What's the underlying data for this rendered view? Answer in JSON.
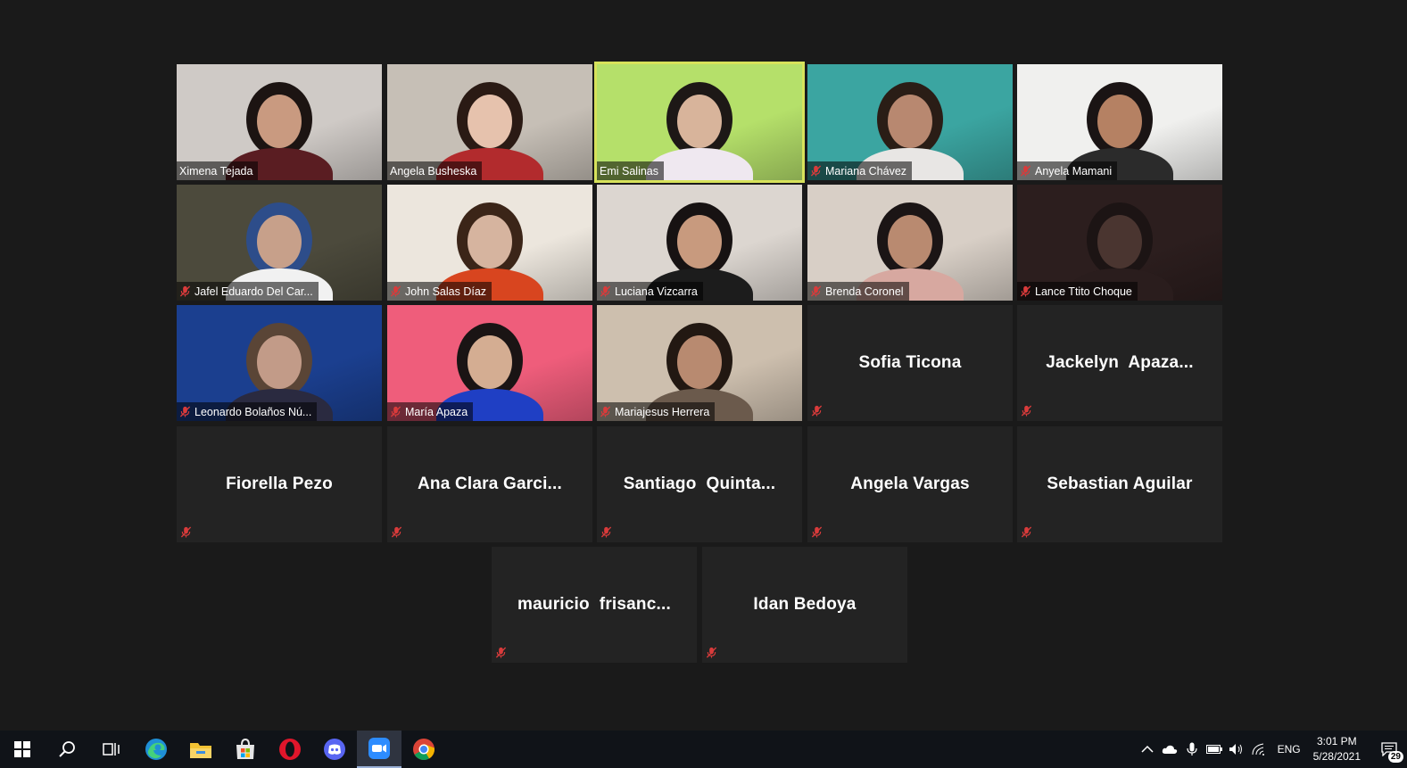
{
  "participants": [
    {
      "name": "Ximena Tejada",
      "video": true,
      "muted": false,
      "active": false,
      "bg": "#cfcac6",
      "skin": "#c99a80",
      "hair": "#1c1412",
      "shirt": "#5a1d22"
    },
    {
      "name": "Angela Busheska",
      "video": true,
      "muted": false,
      "active": false,
      "bg": "#c6bfb6",
      "skin": "#e6c2ad",
      "hair": "#2a1a14",
      "shirt": "#b22b2d"
    },
    {
      "name": "Emi Salinas",
      "video": true,
      "muted": false,
      "active": true,
      "bg": "#b5e06a",
      "skin": "#d8b49b",
      "hair": "#1d1816",
      "shirt": "#efe8f0"
    },
    {
      "name": "Mariana Chávez",
      "video": true,
      "muted": true,
      "active": false,
      "bg": "#3ba5a1",
      "skin": "#b88870",
      "hair": "#2a1d16",
      "shirt": "#e8e6e4"
    },
    {
      "name": "Anyela Mamani",
      "video": true,
      "muted": true,
      "active": false,
      "bg": "#f0f0ee",
      "skin": "#b58163",
      "hair": "#1a1414",
      "shirt": "#2b2b2b"
    },
    {
      "name": "Jafel Eduardo Del Car...",
      "video": true,
      "muted": true,
      "active": false,
      "bg": "#4c4a3c",
      "skin": "#c7a08a",
      "hair": "#2d4d8a",
      "shirt": "#f1f1f1"
    },
    {
      "name": "John Salas Díaz",
      "video": true,
      "muted": true,
      "active": false,
      "bg": "#ece6dd",
      "skin": "#d6b49f",
      "hair": "#3b2518",
      "shirt": "#d8451f"
    },
    {
      "name": "Luciana Vizcarra",
      "video": true,
      "muted": true,
      "active": false,
      "bg": "#dcd6d0",
      "skin": "#c89a7e",
      "hair": "#171212",
      "shirt": "#1c1c1c"
    },
    {
      "name": "Brenda Coronel",
      "video": true,
      "muted": true,
      "active": false,
      "bg": "#d8cfc6",
      "skin": "#b98a70",
      "hair": "#1b1515",
      "shirt": "#d7a8a0"
    },
    {
      "name": "Lance Ttito Choque",
      "video": true,
      "muted": true,
      "active": false,
      "bg": "#2c1e1e",
      "skin": "#4a3530",
      "hair": "#1c1414",
      "shirt": "#2a1d1d"
    },
    {
      "name": "Leonardo Bolaños Nú...",
      "video": true,
      "muted": true,
      "active": false,
      "bg": "#1b3f8f",
      "skin": "#c29b88",
      "hair": "#5a4536",
      "shirt": "#2a2a40"
    },
    {
      "name": "María Apaza",
      "video": true,
      "muted": true,
      "active": false,
      "bg": "#ef5d7b",
      "skin": "#d4ad92",
      "hair": "#1a1414",
      "shirt": "#1f3fc4"
    },
    {
      "name": "Mariajesus Herrera",
      "video": true,
      "muted": true,
      "active": false,
      "bg": "#cdbfae",
      "skin": "#b88a70",
      "hair": "#221812",
      "shirt": "#6b5a4c"
    },
    {
      "name": "Sofia Ticona",
      "video": false,
      "muted": true
    },
    {
      "name": "Jackelyn  Apaza...",
      "video": false,
      "muted": true
    },
    {
      "name": "Fiorella Pezo",
      "video": false,
      "muted": true
    },
    {
      "name": "Ana Clara Garci...",
      "video": false,
      "muted": true
    },
    {
      "name": "Santiago  Quinta...",
      "video": false,
      "muted": true
    },
    {
      "name": "Angela Vargas",
      "video": false,
      "muted": true
    },
    {
      "name": "Sebastian Aguilar",
      "video": false,
      "muted": true
    },
    {
      "name": "mauricio  frisanc...",
      "video": false,
      "muted": true
    },
    {
      "name": "Idan Bedoya",
      "video": false,
      "muted": true
    }
  ],
  "colors": {
    "muted_icon": "#d93b3b",
    "active_speaker_border": "#d7e25b",
    "tile_bg": "#232323",
    "page_bg": "#1a1a1a"
  },
  "taskbar": {
    "apps": [
      {
        "icon": "windows-start-icon"
      },
      {
        "icon": "search-icon"
      },
      {
        "icon": "task-view-icon"
      },
      {
        "icon": "edge-icon"
      },
      {
        "icon": "file-explorer-icon"
      },
      {
        "icon": "microsoft-store-icon"
      },
      {
        "icon": "opera-icon"
      },
      {
        "icon": "discord-icon"
      },
      {
        "icon": "zoom-icon",
        "active": true
      },
      {
        "icon": "chrome-icon"
      }
    ],
    "tray": {
      "language": "ENG",
      "time": "3:01 PM",
      "date": "5/28/2021",
      "notification_count": "29"
    }
  }
}
